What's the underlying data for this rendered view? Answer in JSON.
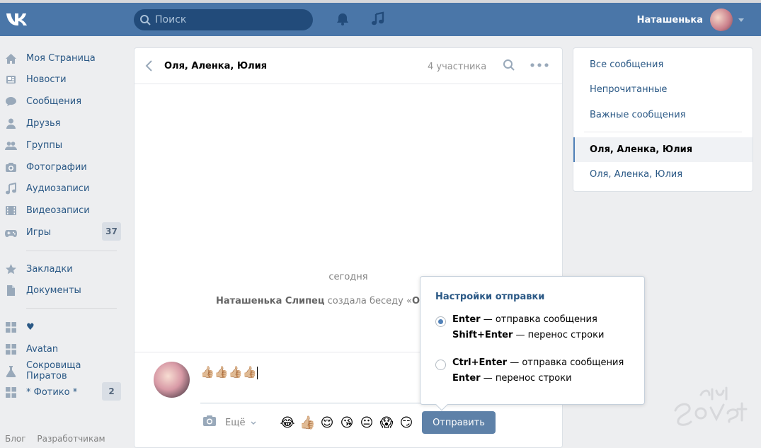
{
  "header": {
    "search_placeholder": "Поиск",
    "user_name": "Наташенька"
  },
  "nav": {
    "items": [
      {
        "label": "Моя Страница",
        "icon": "home-icon"
      },
      {
        "label": "Новости",
        "icon": "news-icon"
      },
      {
        "label": "Сообщения",
        "icon": "messages-icon"
      },
      {
        "label": "Друзья",
        "icon": "friend-icon"
      },
      {
        "label": "Группы",
        "icon": "groups-icon"
      },
      {
        "label": "Фотографии",
        "icon": "camera-icon"
      },
      {
        "label": "Аудиозаписи",
        "icon": "music-icon"
      },
      {
        "label": "Видеозаписи",
        "icon": "video-icon"
      },
      {
        "label": "Игры",
        "icon": "gamepad-icon",
        "badge": "37"
      },
      {
        "label": "Закладки",
        "icon": "star-icon"
      },
      {
        "label": "Документы",
        "icon": "document-icon"
      },
      {
        "label": "♥",
        "icon": "app-grid-icon"
      },
      {
        "label": "Avatan",
        "icon": "app-grid-icon"
      },
      {
        "label": "Сокровища Пиратов",
        "icon": "flask-icon"
      },
      {
        "label": "* Фотико *",
        "icon": "app-grid-icon",
        "badge": "2"
      }
    ],
    "footer": [
      "Блог",
      "Разработчикам"
    ]
  },
  "chat": {
    "title": "Оля, Аленка, Юлия",
    "members": "4 участника",
    "date_divider": "сегодня",
    "system_message": {
      "author": "Наташенька Слипец",
      "text": " создала беседу «",
      "chat_name": "Оля, Ал"
    },
    "input_value": "👍🏼👍🏼👍🏼👍🏼",
    "more_label": "Ещё",
    "emojis": [
      "😂",
      "👍🏼",
      "😌",
      "😘",
      "😐",
      "😱",
      "😏"
    ],
    "send_label": "Отправить"
  },
  "send_settings": {
    "title": "Настройки отправки",
    "options": [
      {
        "selected": true,
        "l1_key": "Enter",
        "l1_text": " — отправка сообщения",
        "l2_key": "Shift+Enter",
        "l2_text": " — перенос строки"
      },
      {
        "selected": false,
        "l1_key": "Ctrl+Enter",
        "l1_text": " — отправка сообщения",
        "l2_key": "Enter",
        "l2_text": " — перенос строки"
      }
    ]
  },
  "right_panel": {
    "filters": [
      "Все сообщения",
      "Непрочитанные",
      "Важные сообщения"
    ],
    "conversations": [
      {
        "title": "Оля, Аленка, Юлия",
        "active": true
      },
      {
        "title": "Оля, Аленка, Юлия",
        "active": false
      }
    ]
  },
  "colors": {
    "header_bg": "#4a76a8",
    "link": "#2a5885",
    "button": "#5e81a8",
    "page_bg": "#edeef0"
  }
}
